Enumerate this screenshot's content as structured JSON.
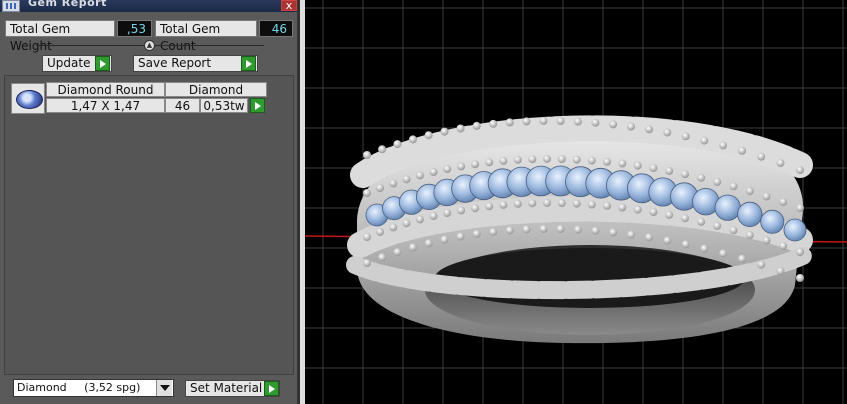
{
  "panel": {
    "title": "Gem Report",
    "close_glyph": "x",
    "total_gem_weight_label": "Total Gem Weight",
    "total_gem_weight_value": ",53",
    "total_gem_count_label": "Total Gem Count",
    "total_gem_count_value": "46",
    "update_label": "Update",
    "save_report_label": "Save Report",
    "set_material_label": "Set Material"
  },
  "gems": [
    {
      "icon": "round-diamond-icon",
      "cut": "Diamond Round",
      "size": "1,47 X 1,47",
      "material": "Diamond",
      "count": "46",
      "weight": "0,53tw"
    }
  ],
  "material_select": {
    "selected": "Diamond     (3,52 spg)"
  },
  "viewport": {
    "background": "#000000",
    "grid_color": "#3c3c3c",
    "axis_color": "#c01818",
    "stone_color": "#9cb8de",
    "metal_color": "#c9c9c9"
  }
}
